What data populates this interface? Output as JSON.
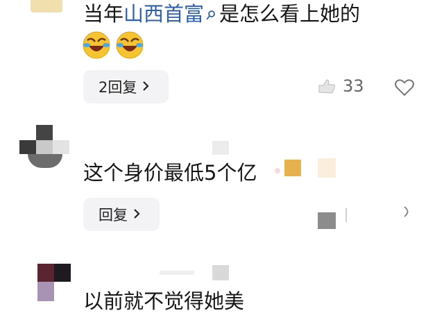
{
  "comments": [
    {
      "text_prefix": "当年",
      "link_text": "山西首富",
      "text_suffix": "是怎么看上她的",
      "emojis": [
        "😂",
        "😂"
      ],
      "reply_label": "2回复",
      "like_count": "33"
    },
    {
      "text": "这个身价最低5个亿",
      "reply_label": "回复"
    },
    {
      "text": "以前就不觉得她美"
    }
  ],
  "icons": {
    "search": "search-icon",
    "chevron": "chevron-right-icon",
    "thumbs_up": "thumbs-up-icon",
    "heart": "heart-icon"
  },
  "colors": {
    "link": "#2f5fa8",
    "reply_bg": "#f3f3f5",
    "avatar_placeholder": "#e8c87a"
  }
}
